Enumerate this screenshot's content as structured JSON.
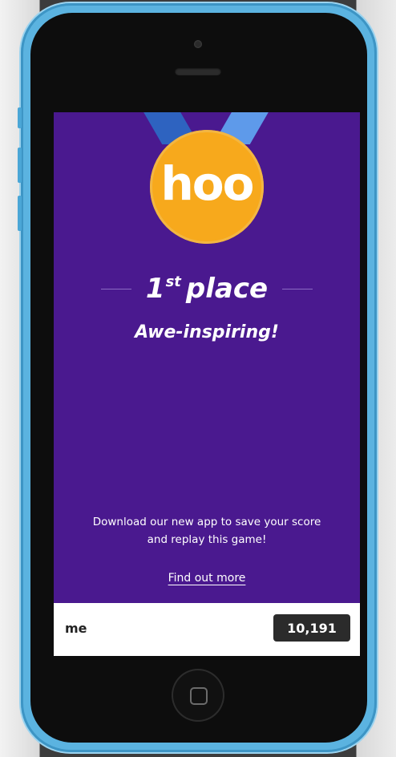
{
  "medal": {
    "logo_text": "hoo",
    "color": "#f7a91c",
    "ribbon_colors": [
      "#2e63c0",
      "#5e9aea"
    ]
  },
  "result": {
    "place_number": "1",
    "place_suffix": "st",
    "place_word": "place",
    "tagline": "Awe-inspiring!"
  },
  "promo": {
    "line1": "Download our new app to save your score",
    "line2": "and replay this game!",
    "link_label": "Find out more"
  },
  "scoreboard": {
    "player": "me",
    "score": "10,191"
  },
  "colors": {
    "screen_bg": "#4a198f",
    "phone_shell": "#5bb3e0",
    "score_badge": "#2b2b2b"
  },
  "icons": {
    "home": "home-button-icon",
    "camera": "front-camera-icon",
    "speaker": "speaker-grille-icon"
  }
}
